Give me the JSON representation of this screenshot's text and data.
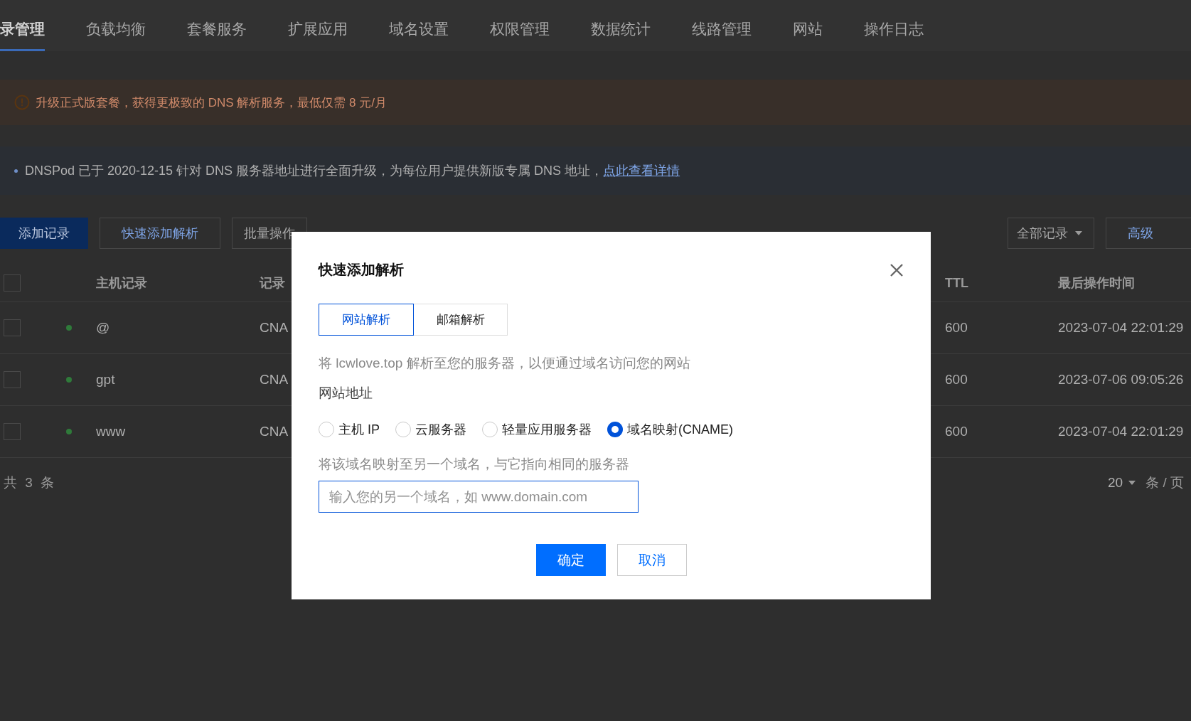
{
  "nav_tabs": [
    {
      "label": "录管理",
      "selected": true
    },
    {
      "label": "负载均衡",
      "selected": false
    },
    {
      "label": "套餐服务",
      "selected": false
    },
    {
      "label": "扩展应用",
      "selected": false
    },
    {
      "label": "域名设置",
      "selected": false
    },
    {
      "label": "权限管理",
      "selected": false
    },
    {
      "label": "数据统计",
      "selected": false
    },
    {
      "label": "线路管理",
      "selected": false
    },
    {
      "label": "网站",
      "selected": false
    },
    {
      "label": "操作日志",
      "selected": false
    }
  ],
  "upgrade_alert": {
    "text": "升级正式版套餐，获得更极致的 DNS 解析服务，最低仅需 8 元/月"
  },
  "notice": {
    "text": "DNSPod 已于 2020-12-15 针对 DNS 服务器地址进行全面升级，为每位用户提供新版专属 DNS 地址，",
    "link": "点此查看详情"
  },
  "toolbar": {
    "buttons": [
      {
        "label": "添加记录",
        "kind": "primary"
      },
      {
        "label": "快速添加解析",
        "kind": "link"
      },
      {
        "label": "批量操作",
        "kind": "plain"
      }
    ],
    "filter": "全部记录",
    "advanced": "高级"
  },
  "table": {
    "header_checked": false,
    "columns": [
      "主机记录",
      "记录",
      "TTL",
      "最后操作时间"
    ],
    "rows": [
      {
        "checked": false,
        "host": "@",
        "type": "CNA",
        "ttl": "600",
        "time": "2023-07-04 22:01:29"
      },
      {
        "checked": false,
        "host": "gpt",
        "type": "CNA",
        "ttl": "600",
        "time": "2023-07-06 09:05:26"
      },
      {
        "checked": false,
        "host": "www",
        "type": "CNA",
        "ttl": "600",
        "time": "2023-07-04 22:01:29"
      }
    ]
  },
  "footer": {
    "total": "共 3 条",
    "page_size": "20",
    "per_page": "条 / 页"
  },
  "dialog": {
    "title": "快速添加解析",
    "tabs": [
      {
        "label": "网站解析",
        "selected": true
      },
      {
        "label": "邮箱解析",
        "selected": false
      }
    ],
    "description": "将 lcwlove.top 解析至您的服务器，以便通过域名访问您的网站",
    "field_label": "网站地址",
    "radios": [
      {
        "label": "主机 IP",
        "selected": false
      },
      {
        "label": "云服务器",
        "selected": false
      },
      {
        "label": "轻量应用服务器",
        "selected": false
      },
      {
        "label": "域名映射(CNAME)",
        "selected": true
      }
    ],
    "hint": "将该域名映射至另一个域名，与它指向相同的服务器",
    "input": {
      "placeholder": "输入您的另一个域名，如 www.domain.com"
    },
    "confirm": "确定",
    "cancel": "取消"
  }
}
